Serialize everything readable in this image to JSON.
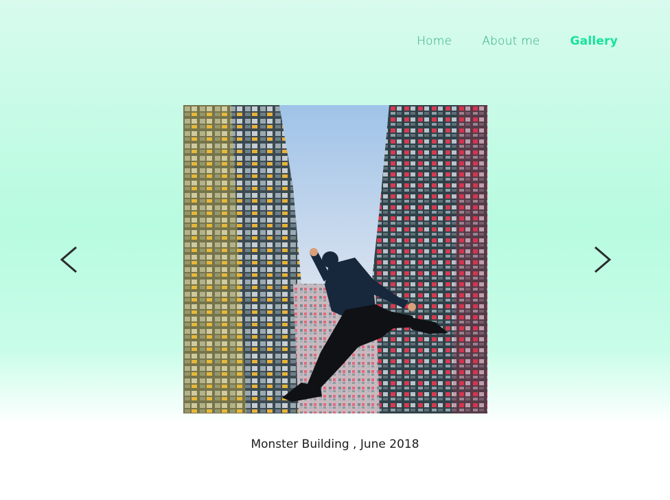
{
  "nav": {
    "items": [
      {
        "label": "Home",
        "active": false
      },
      {
        "label": "About me",
        "active": false
      },
      {
        "label": "Gallery",
        "active": true
      }
    ]
  },
  "gallery": {
    "caption": "Monster Building , June 2018",
    "prev_icon": "chevron-left-icon",
    "next_icon": "chevron-right-icon"
  },
  "colors": {
    "nav_link": "#2aa981",
    "nav_active": "#16e39a",
    "arrow": "#2b2b2b",
    "caption": "#1b1b1b"
  }
}
